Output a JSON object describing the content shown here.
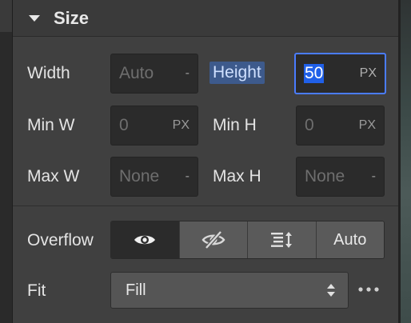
{
  "section": {
    "title": "Size"
  },
  "width": {
    "label": "Width",
    "value": "Auto",
    "unit": "-"
  },
  "height": {
    "label": "Height",
    "value": "50",
    "unit": "PX"
  },
  "min_w": {
    "label": "Min W",
    "value": "0",
    "unit": "PX"
  },
  "min_h": {
    "label": "Min H",
    "value": "0",
    "unit": "PX"
  },
  "max_w": {
    "label": "Max W",
    "value": "None",
    "unit": "-"
  },
  "max_h": {
    "label": "Max H",
    "value": "None",
    "unit": "-"
  },
  "overflow": {
    "label": "Overflow",
    "options": [
      {
        "icon": "eye-icon",
        "selected": true
      },
      {
        "icon": "eye-slash-icon",
        "selected": false
      },
      {
        "icon": "scroll-icon",
        "selected": false
      },
      {
        "label": "Auto",
        "selected": false
      }
    ]
  },
  "fit": {
    "label": "Fit",
    "value": "Fill"
  },
  "colors": {
    "panel_bg": "#404040",
    "field_bg": "#2b2b2b",
    "accent_blue": "#4a7cff",
    "selection_blue": "#2060e8"
  }
}
